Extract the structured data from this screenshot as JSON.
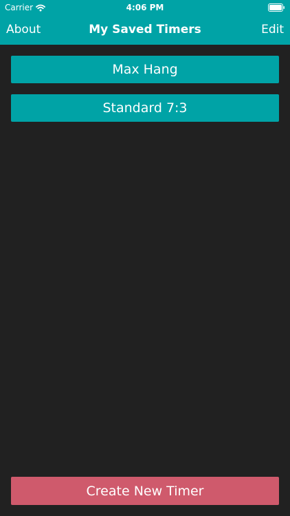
{
  "status_bar": {
    "carrier": "Carrier",
    "time": "4:06 PM"
  },
  "nav": {
    "left_label": "About",
    "title": "My Saved Timers",
    "right_label": "Edit"
  },
  "timers": [
    {
      "label": "Max Hang"
    },
    {
      "label": "Standard 7:3"
    }
  ],
  "create_button": {
    "label": "Create New Timer"
  },
  "colors": {
    "accent": "#00a3a6",
    "background": "#212121",
    "create": "#cf5a6c"
  }
}
